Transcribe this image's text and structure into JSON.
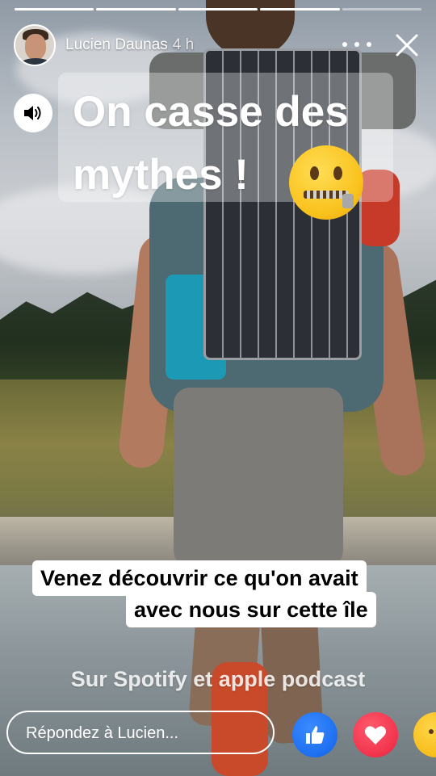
{
  "story": {
    "progress": {
      "total_segments": 5,
      "completed_segments": 4
    },
    "header": {
      "user_name": "Lucien Daunas",
      "time": "4 h"
    },
    "headline": {
      "line1": "On casse des",
      "line2": "mythes !"
    },
    "captions": {
      "line1": "Venez découvrir ce qu'on avait",
      "line2": "avec nous sur cette île"
    },
    "subcaption": "Sur Spotify et apple podcast",
    "reply": {
      "placeholder": "Répondez à Lucien..."
    },
    "reactions": [
      "like-icon",
      "love-icon",
      "care-icon"
    ],
    "colors": {
      "like": "#1d6ff0",
      "love": "#f1334b",
      "care": "#f8bd1a"
    }
  }
}
